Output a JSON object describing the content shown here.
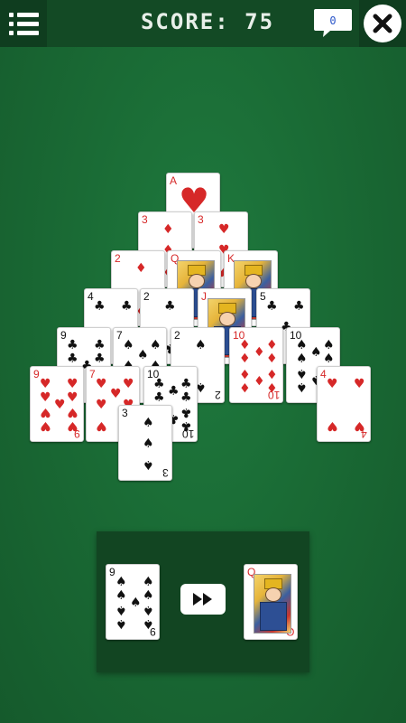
{
  "header": {
    "score_text": "SCORE: 75",
    "chat_count": "0"
  },
  "colors": {
    "felt": "#1a6b35",
    "topbar": "#134a25",
    "red_suit": "#d62828"
  },
  "icons": {
    "menu": "menu-icon",
    "chat": "chat-bubble-icon",
    "close": "close-icon",
    "deal": "fast-forward-icon"
  },
  "pyramid": [
    {
      "id": "r1c1",
      "rank": "A",
      "suit": "♥"
    },
    {
      "id": "r2c1",
      "rank": "3",
      "suit": "♦"
    },
    {
      "id": "r2c2",
      "rank": "3",
      "suit": "♥"
    },
    {
      "id": "r3c1",
      "rank": "2",
      "suit": "♦"
    },
    {
      "id": "r3c2",
      "rank": "Q",
      "suit": "♦"
    },
    {
      "id": "r3c3",
      "rank": "K",
      "suit": "♦"
    },
    {
      "id": "r4c1",
      "rank": "4",
      "suit": "♣"
    },
    {
      "id": "r4c2",
      "rank": "2",
      "suit": "♣"
    },
    {
      "id": "r4c3",
      "rank": "J",
      "suit": "♦"
    },
    {
      "id": "r4c4",
      "rank": "5",
      "suit": "♣"
    },
    {
      "id": "r5c1",
      "rank": "9",
      "suit": "♣"
    },
    {
      "id": "r5c2",
      "rank": "7",
      "suit": "♠"
    },
    {
      "id": "r5c3",
      "rank": "2",
      "suit": "♠"
    },
    {
      "id": "r5c4",
      "rank": "10",
      "suit": "♦"
    },
    {
      "id": "r5c5",
      "rank": "10",
      "suit": "♠"
    },
    {
      "id": "r6c1",
      "rank": "9",
      "suit": "♥"
    },
    {
      "id": "r6c2",
      "rank": "7",
      "suit": "♥"
    },
    {
      "id": "r6c3",
      "rank": "10",
      "suit": "♣"
    },
    {
      "id": "r6c6",
      "rank": "4",
      "suit": "♥"
    },
    {
      "id": "r7c3",
      "rank": "3",
      "suit": "♠"
    }
  ],
  "stock": {
    "draw_card": {
      "rank": "9",
      "suit": "♠"
    },
    "waste_card": {
      "rank": "Q",
      "suit": "♦"
    }
  }
}
